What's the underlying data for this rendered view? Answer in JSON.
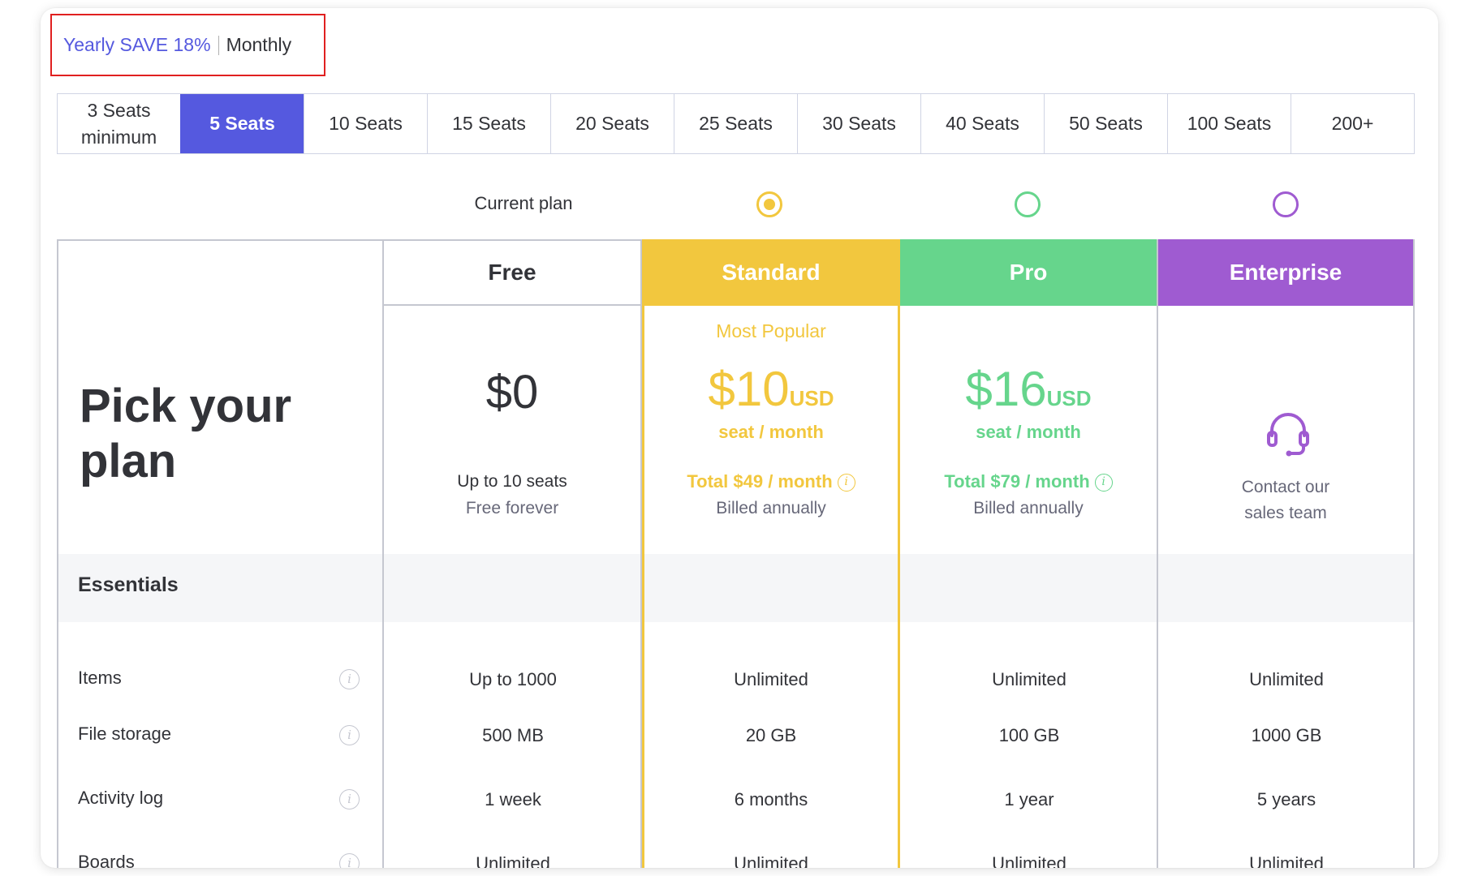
{
  "billing": {
    "yearly_label": "Yearly SAVE 18%",
    "monthly_label": "Monthly"
  },
  "seats": [
    {
      "line1": "3 Seats",
      "line2": "minimum"
    },
    {
      "line1": "5 Seats",
      "line2": ""
    },
    {
      "line1": "10 Seats",
      "line2": ""
    },
    {
      "line1": "15 Seats",
      "line2": ""
    },
    {
      "line1": "20 Seats",
      "line2": ""
    },
    {
      "line1": "25 Seats",
      "line2": ""
    },
    {
      "line1": "30 Seats",
      "line2": ""
    },
    {
      "line1": "40 Seats",
      "line2": ""
    },
    {
      "line1": "50 Seats",
      "line2": ""
    },
    {
      "line1": "100 Seats",
      "line2": ""
    },
    {
      "line1": "200+",
      "line2": ""
    }
  ],
  "selected_seat": "5 Seats",
  "current_plan_label": "Current plan",
  "title": "Pick your plan",
  "plans": {
    "free": {
      "name": "Free",
      "price": "$0",
      "sub1": "Up to 10 seats",
      "sub2": "Free forever"
    },
    "standard": {
      "name": "Standard",
      "badge": "Most Popular",
      "price": "$10",
      "currency": "USD",
      "per": "seat / month",
      "total": "Total $49 / month",
      "billed": "Billed annually",
      "color": "#f2c73e"
    },
    "pro": {
      "name": "Pro",
      "price": "$16",
      "currency": "USD",
      "per": "seat / month",
      "total": "Total $79 / month",
      "billed": "Billed annually",
      "color": "#66d58c"
    },
    "enterprise": {
      "name": "Enterprise",
      "contact_line1": "Contact our",
      "contact_line2": "sales team",
      "color": "#9f5bd1"
    }
  },
  "essentials_label": "Essentials",
  "features": [
    {
      "label": "Items",
      "free": "Up to 1000",
      "standard": "Unlimited",
      "pro": "Unlimited",
      "enterprise": "Unlimited"
    },
    {
      "label": "File storage",
      "free": "500 MB",
      "standard": "20 GB",
      "pro": "100 GB",
      "enterprise": "1000 GB"
    },
    {
      "label": "Activity log",
      "free": "1 week",
      "standard": "6 months",
      "pro": "1 year",
      "enterprise": "5 years"
    },
    {
      "label": "Boards",
      "free": "Unlimited",
      "standard": "Unlimited",
      "pro": "Unlimited",
      "enterprise": "Unlimited"
    }
  ],
  "colors": {
    "accent": "#5559df",
    "standard": "#f2c73e",
    "pro": "#66d58c",
    "enterprise": "#9f5bd1"
  },
  "icons": {
    "info": "info-icon",
    "contact": "headset-icon"
  }
}
